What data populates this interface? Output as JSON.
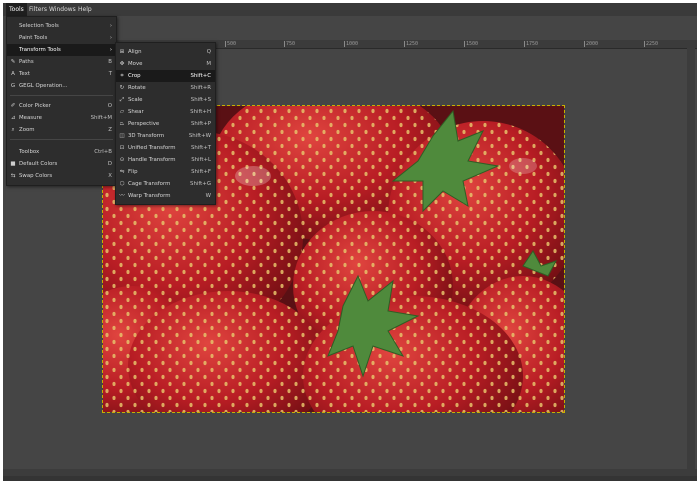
{
  "menubar": {
    "items": [
      {
        "label": "Tools",
        "active": true
      },
      {
        "label": "Filters",
        "active": false
      },
      {
        "label": "Windows",
        "active": false
      },
      {
        "label": "Help",
        "active": false
      }
    ]
  },
  "ruler": {
    "ticks": [
      "500",
      "750",
      "1000",
      "1250",
      "1500",
      "1750",
      "2000",
      "2250"
    ]
  },
  "tools_menu": {
    "items": [
      {
        "label": "Selection Tools",
        "shortcut": "›",
        "icon": ""
      },
      {
        "label": "Paint Tools",
        "shortcut": "›",
        "icon": ""
      },
      {
        "label": "Transform Tools",
        "shortcut": "›",
        "icon": ""
      },
      {
        "label": "Paths",
        "shortcut": "B",
        "icon": "✎"
      },
      {
        "label": "Text",
        "shortcut": "T",
        "icon": "A"
      },
      {
        "label": "GEGL Operation...",
        "shortcut": "",
        "icon": "G"
      },
      {
        "label": "Color Picker",
        "shortcut": "O",
        "icon": "✐"
      },
      {
        "label": "Measure",
        "shortcut": "Shift+M",
        "icon": "⊿"
      },
      {
        "label": "Zoom",
        "shortcut": "Z",
        "icon": "⌕"
      },
      {
        "label": "Toolbox",
        "shortcut": "Ctrl+B",
        "icon": ""
      },
      {
        "label": "Default Colors",
        "shortcut": "D",
        "icon": "■"
      },
      {
        "label": "Swap Colors",
        "shortcut": "X",
        "icon": "⇆"
      }
    ]
  },
  "transform_menu": {
    "items": [
      {
        "label": "Align",
        "shortcut": "Q",
        "icon": "⊞"
      },
      {
        "label": "Move",
        "shortcut": "M",
        "icon": "✥"
      },
      {
        "label": "Crop",
        "shortcut": "Shift+C",
        "icon": "⌗"
      },
      {
        "label": "Rotate",
        "shortcut": "Shift+R",
        "icon": "↻"
      },
      {
        "label": "Scale",
        "shortcut": "Shift+S",
        "icon": "⤢"
      },
      {
        "label": "Shear",
        "shortcut": "Shift+H",
        "icon": "▱"
      },
      {
        "label": "Perspective",
        "shortcut": "Shift+P",
        "icon": "⏢"
      },
      {
        "label": "3D Transform",
        "shortcut": "Shift+W",
        "icon": "◫"
      },
      {
        "label": "Unified Transform",
        "shortcut": "Shift+T",
        "icon": "⊡"
      },
      {
        "label": "Handle Transform",
        "shortcut": "Shift+L",
        "icon": "⊙"
      },
      {
        "label": "Flip",
        "shortcut": "Shift+F",
        "icon": "⇋"
      },
      {
        "label": "Cage Transform",
        "shortcut": "Shift+G",
        "icon": "⬡"
      },
      {
        "label": "Warp Transform",
        "shortcut": "W",
        "icon": "〰"
      }
    ]
  },
  "colors": {
    "canvas_bg": "#454545",
    "menu_bg": "#2d2d2d",
    "highlight": "#1a1a1a",
    "strawberry": "#c8232a",
    "leaf": "#4f8a3c",
    "selection_border": "#c8b000"
  }
}
